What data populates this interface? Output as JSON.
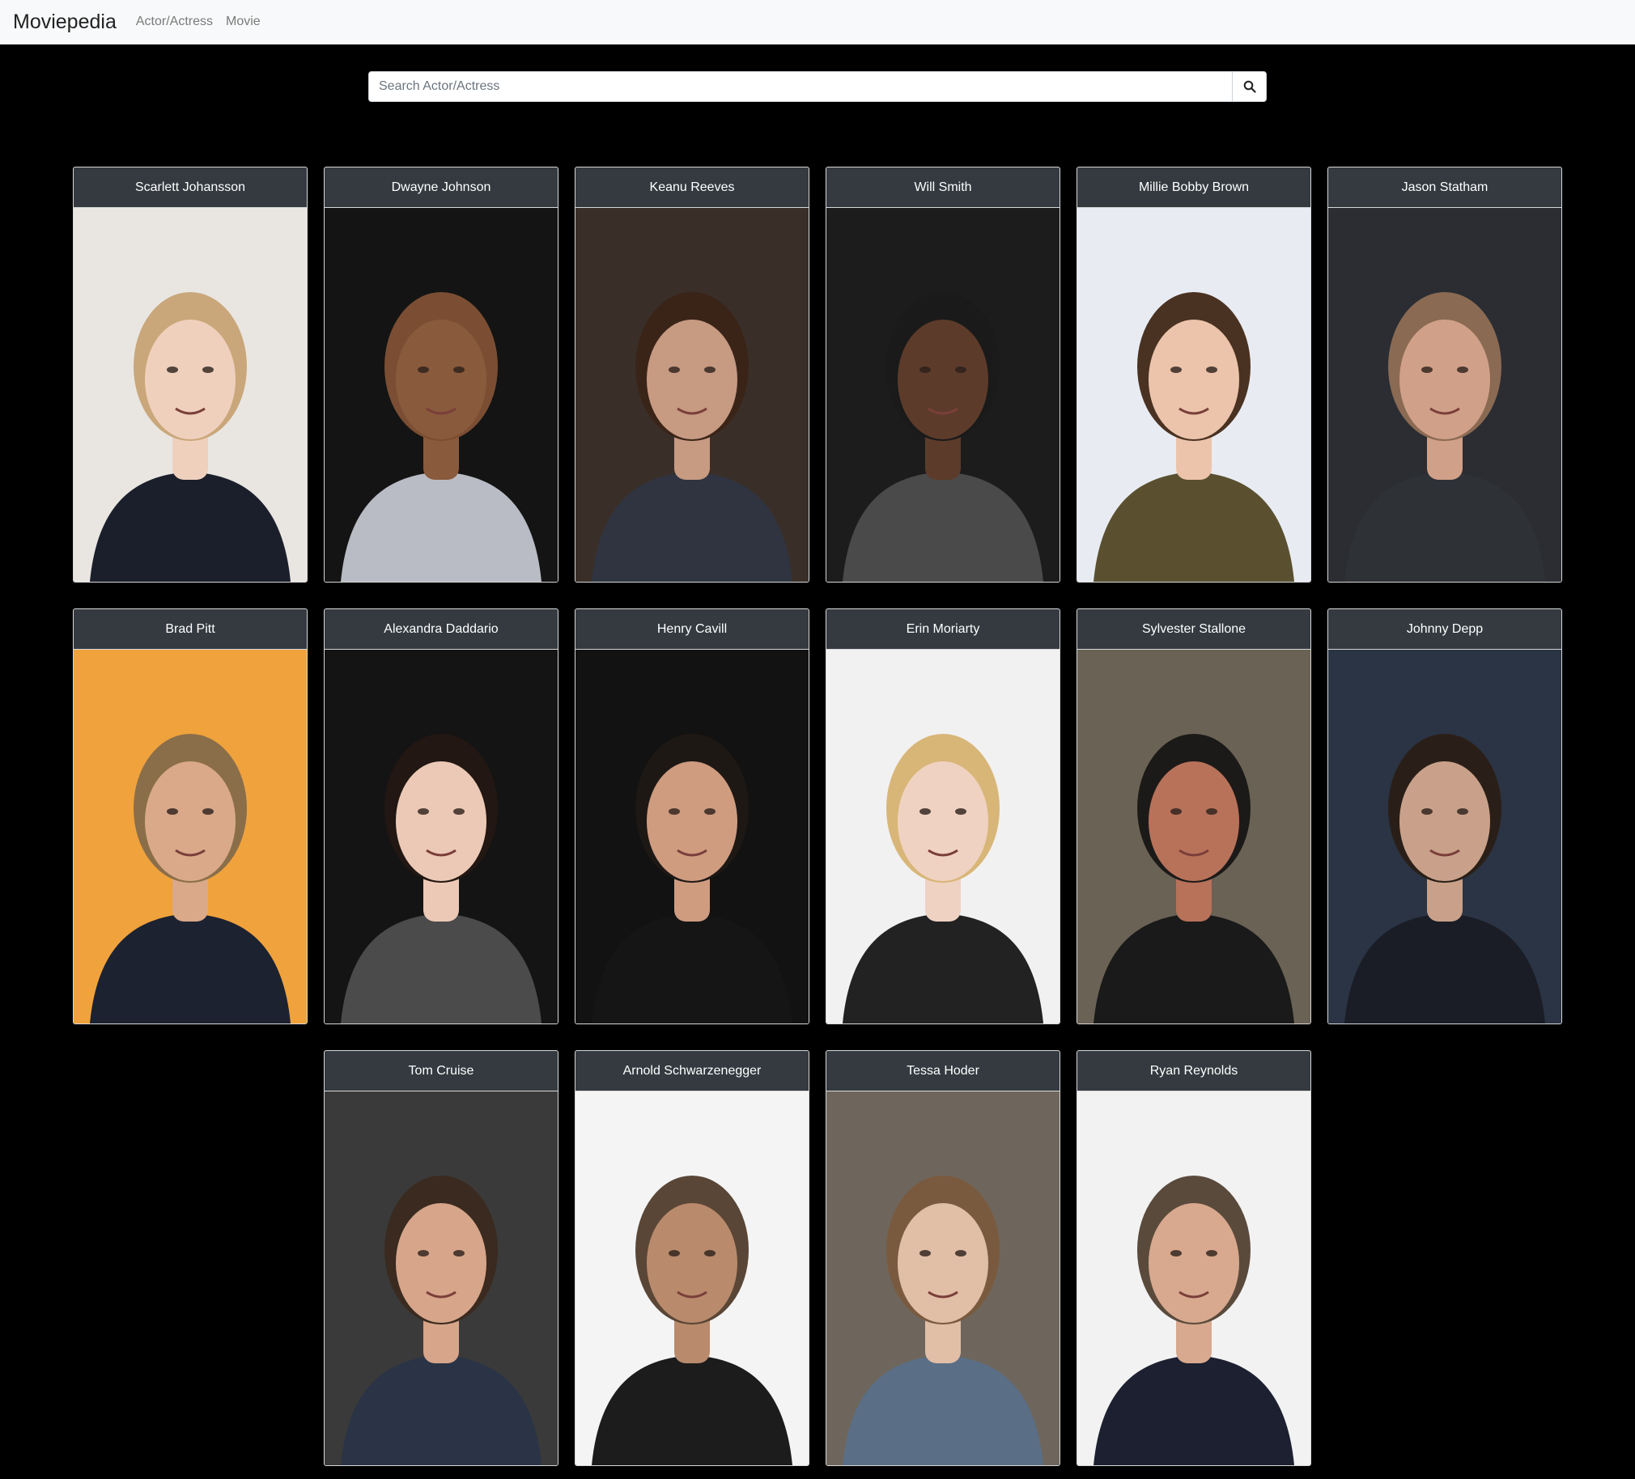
{
  "navbar": {
    "brand": "Moviepedia",
    "links": [
      {
        "label": "Actor/Actress"
      },
      {
        "label": "Movie"
      }
    ]
  },
  "search": {
    "placeholder": "Search Actor/Actress",
    "value": "",
    "button_icon": "search-icon"
  },
  "actors": [
    {
      "name": "Scarlett Johansson",
      "bg": "#e9e6e2",
      "skin": "#efd0bd",
      "hair": "#c9a77a",
      "shirt": "#1b1f2b"
    },
    {
      "name": "Dwayne Johnson",
      "bg": "#141414",
      "skin": "#8a5a3c",
      "hair": "#7b4e33",
      "shirt": "#b9bcc4"
    },
    {
      "name": "Keanu Reeves",
      "bg": "#3a2e28",
      "skin": "#c79a82",
      "hair": "#3a2418",
      "shirt": "#2f3440"
    },
    {
      "name": "Will Smith",
      "bg": "#1c1c1c",
      "skin": "#5d3b2a",
      "hair": "#1a1a1a",
      "shirt": "#4a4a4a"
    },
    {
      "name": "Millie Bobby Brown",
      "bg": "#e8ecf2",
      "skin": "#ecc4ab",
      "hair": "#4a3222",
      "shirt": "#5a5030"
    },
    {
      "name": "Jason Statham",
      "bg": "#2b2d33",
      "skin": "#d1a088",
      "hair": "#8a6a52",
      "shirt": "#2e3136"
    },
    {
      "name": "Brad Pitt",
      "bg": "#f0a23c",
      "skin": "#d9a98a",
      "hair": "#8a6e4a",
      "shirt": "#1c2230"
    },
    {
      "name": "Alexandra Daddario",
      "bg": "#141414",
      "skin": "#ecc9b6",
      "hair": "#221712",
      "shirt": "#4b4b4b"
    },
    {
      "name": "Henry Cavill",
      "bg": "#121212",
      "skin": "#cf9c80",
      "hair": "#1e1814",
      "shirt": "#151515"
    },
    {
      "name": "Erin Moriarty",
      "bg": "#f1f1f1",
      "skin": "#f0d2c2",
      "hair": "#d8b678",
      "shirt": "#222222"
    },
    {
      "name": "Sylvester Stallone",
      "bg": "#6a6254",
      "skin": "#b8725a",
      "hair": "#1c1a18",
      "shirt": "#1a1a1a"
    },
    {
      "name": "Johnny Depp",
      "bg": "#2a3444",
      "skin": "#c9a18a",
      "hair": "#2a1f18",
      "shirt": "#1a1d26"
    },
    {
      "name": "Tom Cruise",
      "bg": "#3a3a3a",
      "skin": "#d6a58a",
      "hair": "#3a2a1f",
      "shirt": "#2a3446"
    },
    {
      "name": "Arnold Schwarzenegger",
      "bg": "#f4f4f4",
      "skin": "#b98a6c",
      "hair": "#5a4636",
      "shirt": "#1c1c1c"
    },
    {
      "name": "Tessa Hoder",
      "bg": "#6e665c",
      "skin": "#e1bea6",
      "hair": "#7a5a3e",
      "shirt": "#5a6e86"
    },
    {
      "name": "Ryan Reynolds",
      "bg": "#f2f2f2",
      "skin": "#d8a98e",
      "hair": "#5a4a3c",
      "shirt": "#1c2030"
    }
  ]
}
